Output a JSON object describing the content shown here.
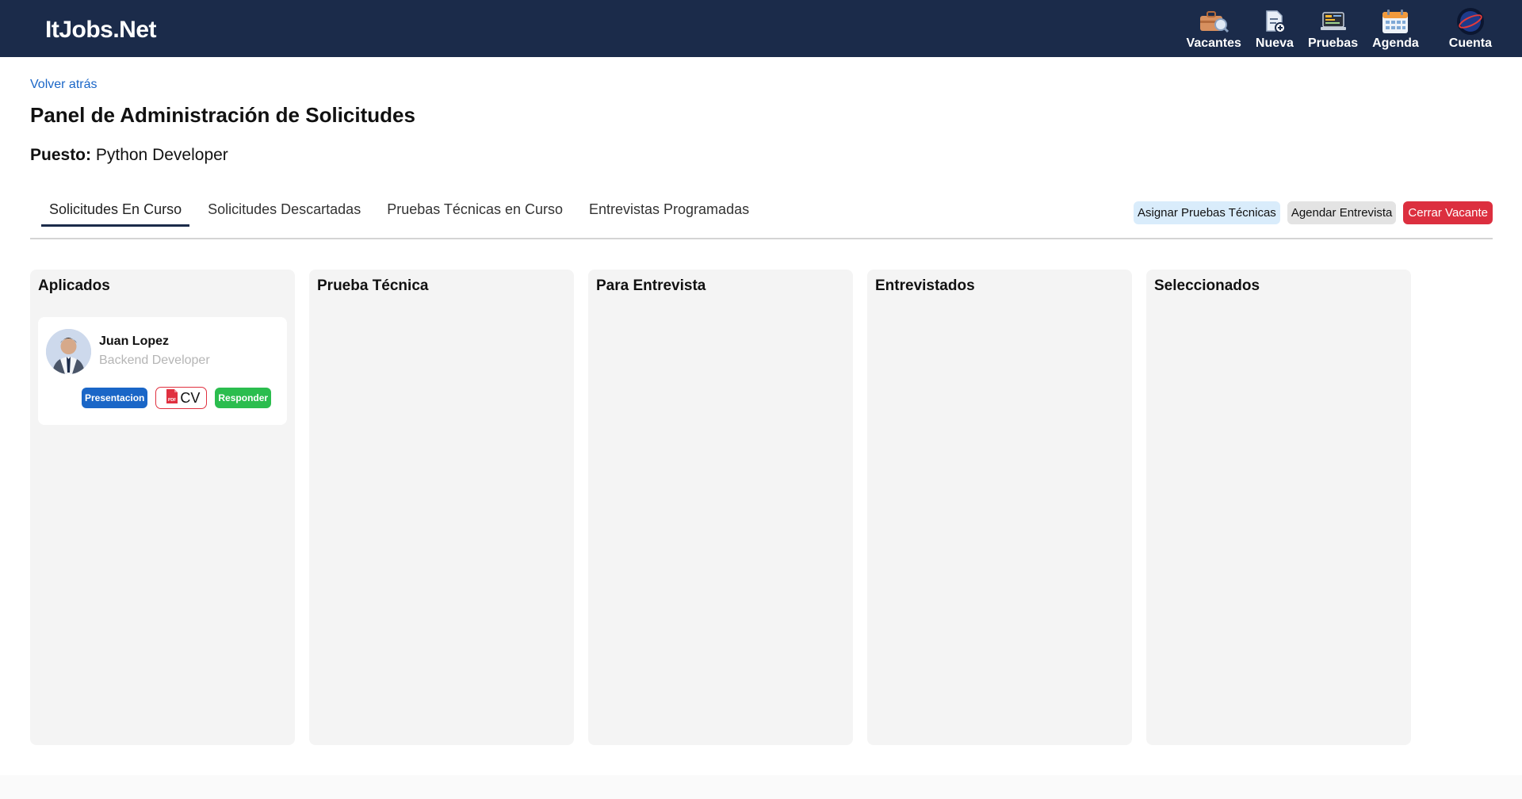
{
  "navbar": {
    "brand": "ItJobs.Net",
    "items": [
      {
        "label": "Vacantes",
        "icon": "briefcase-search-icon"
      },
      {
        "label": "Nueva",
        "icon": "new-document-icon"
      },
      {
        "label": "Pruebas",
        "icon": "code-laptop-icon"
      },
      {
        "label": "Agenda",
        "icon": "calendar-icon"
      },
      {
        "label": "Cuenta",
        "icon": "account-avatar-icon"
      }
    ]
  },
  "page": {
    "back_link": "Volver atrás",
    "title": "Panel de Administración de Solicitudes",
    "puesto_label": "Puesto:",
    "puesto_value": "Python Developer"
  },
  "tabs": [
    {
      "label": "Solicitudes En Curso",
      "active": true
    },
    {
      "label": "Solicitudes Descartadas",
      "active": false
    },
    {
      "label": "Pruebas Técnicas en Curso",
      "active": false
    },
    {
      "label": "Entrevistas Programadas",
      "active": false
    }
  ],
  "actions": {
    "assign_tests": "Asignar Pruebas Técnicas",
    "schedule_interview": "Agendar Entrevista",
    "close_vacancy": "Cerrar Vacante"
  },
  "columns": [
    {
      "title": "Aplicados",
      "cards": [
        {
          "name": "Juan Lopez",
          "role": "Backend Developer",
          "presentation_label": "Presentacion",
          "cv_label": "CV",
          "cv_icon_text": "PDF",
          "respond_label": "Responder"
        }
      ]
    },
    {
      "title": "Prueba Técnica",
      "cards": []
    },
    {
      "title": "Para Entrevista",
      "cards": []
    },
    {
      "title": "Entrevistados",
      "cards": []
    },
    {
      "title": "Seleccionados",
      "cards": []
    }
  ],
  "colors": {
    "navbar_bg": "#1b2b4a",
    "link": "#1a66c7",
    "danger": "#dc2f3f",
    "success": "#2bbd4e",
    "column_bg": "#f4f4f4"
  }
}
